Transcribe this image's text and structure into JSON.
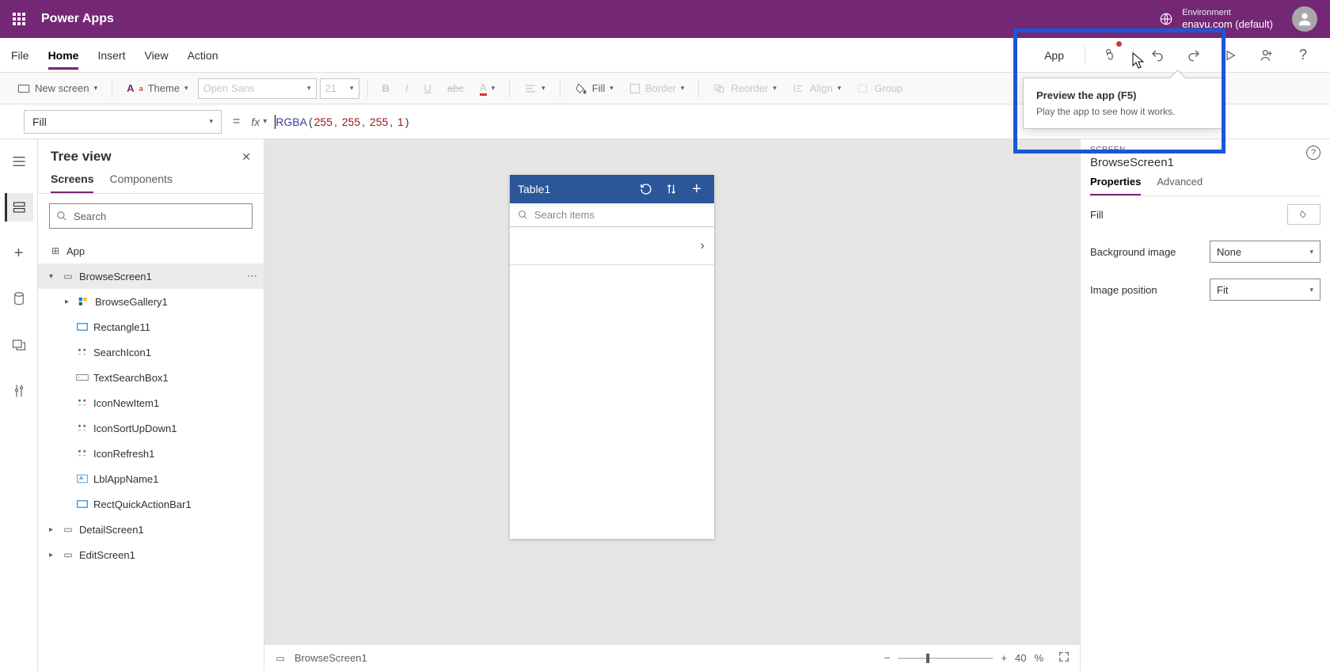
{
  "topbar": {
    "brand": "Power Apps",
    "env_label": "Environment",
    "env_name": "enavu.com (default)"
  },
  "menubar": {
    "items": [
      "File",
      "Home",
      "Insert",
      "View",
      "Action"
    ],
    "active": "Home",
    "app_btn": "App"
  },
  "ribbon": {
    "new_screen": "New screen",
    "theme": "Theme",
    "font": "Open Sans",
    "font_size": "21",
    "fill": "Fill",
    "border": "Border",
    "reorder": "Reorder",
    "align": "Align",
    "group": "Group"
  },
  "formula": {
    "property": "Fill",
    "fx": "fx",
    "fn": "RGBA",
    "args": [
      "255",
      "255",
      "255",
      "1"
    ]
  },
  "tree": {
    "title": "Tree view",
    "tabs": {
      "screens": "Screens",
      "components": "Components"
    },
    "search_placeholder": "Search",
    "nodes": {
      "app": "App",
      "browse_screen": "BrowseScreen1",
      "gallery": "BrowseGallery1",
      "rect11": "Rectangle11",
      "search_icon": "SearchIcon1",
      "text_search": "TextSearchBox1",
      "icon_new": "IconNewItem1",
      "icon_sort": "IconSortUpDown1",
      "icon_refresh": "IconRefresh1",
      "lbl_app": "LblAppName1",
      "rect_quick": "RectQuickActionBar1",
      "detail": "DetailScreen1",
      "edit": "EditScreen1"
    }
  },
  "phone": {
    "title": "Table1",
    "search_placeholder": "Search items"
  },
  "footer": {
    "screen": "BrowseScreen1",
    "zoom": "40",
    "zoom_pct": "%"
  },
  "props": {
    "label": "SCREEN",
    "title": "BrowseScreen1",
    "tab_properties": "Properties",
    "tab_advanced": "Advanced",
    "fill_label": "Fill",
    "bg_label": "Background image",
    "bg_value": "None",
    "imgpos_label": "Image position",
    "imgpos_value": "Fit"
  },
  "tooltip": {
    "title": "Preview the app (F5)",
    "body": "Play the app to see how it works."
  }
}
